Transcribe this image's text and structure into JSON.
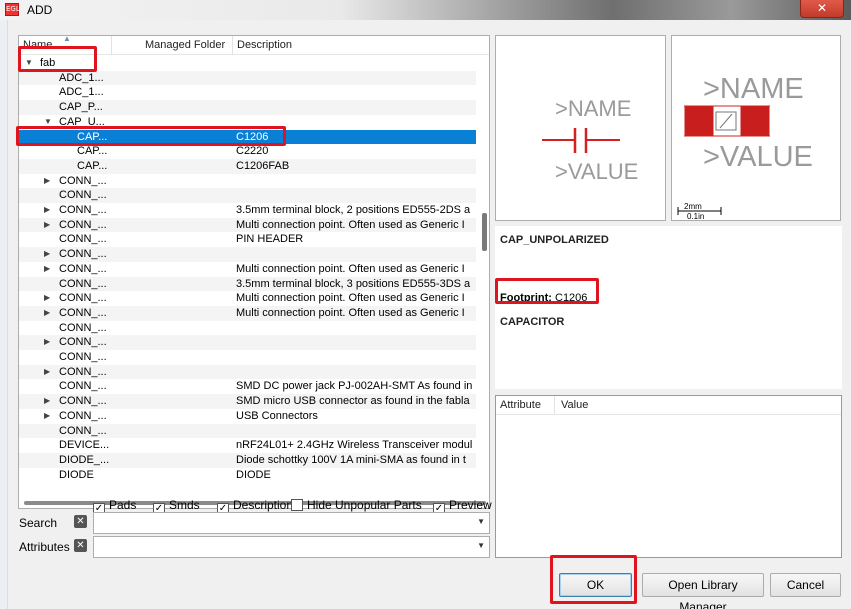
{
  "window": {
    "title": "ADD",
    "app_icon_text": "EGL",
    "close_glyph": "✕"
  },
  "tree": {
    "columns": [
      "Name",
      "Managed Folder",
      "Description"
    ],
    "rows": [
      {
        "name": "fab",
        "desc": "",
        "level": 0,
        "arrow": "▼"
      },
      {
        "name": "ADC_1...",
        "desc": "",
        "level": 1,
        "arrow": ""
      },
      {
        "name": "ADC_1...",
        "desc": "",
        "level": 1,
        "arrow": ""
      },
      {
        "name": "CAP_P...",
        "desc": "",
        "level": 1,
        "arrow": ""
      },
      {
        "name": "CAP_U...",
        "desc": "",
        "level": 1,
        "arrow": "▼"
      },
      {
        "name": "CAP...",
        "desc": "C1206",
        "level": 2,
        "arrow": "",
        "selected": true
      },
      {
        "name": "CAP...",
        "desc": "C2220",
        "level": 2,
        "arrow": ""
      },
      {
        "name": "CAP...",
        "desc": "C1206FAB",
        "level": 2,
        "arrow": ""
      },
      {
        "name": "CONN_...",
        "desc": "",
        "level": 1,
        "arrow": "▶"
      },
      {
        "name": "CONN_...",
        "desc": "",
        "level": 1,
        "arrow": ""
      },
      {
        "name": "CONN_...",
        "desc": "3.5mm terminal block, 2 positions ED555-2DS a",
        "level": 1,
        "arrow": "▶"
      },
      {
        "name": "CONN_...",
        "desc": "Multi connection point. Often used as Generic I",
        "level": 1,
        "arrow": "▶"
      },
      {
        "name": "CONN_...",
        "desc": "PIN HEADER",
        "level": 1,
        "arrow": ""
      },
      {
        "name": "CONN_...",
        "desc": "",
        "level": 1,
        "arrow": "▶"
      },
      {
        "name": "CONN_...",
        "desc": "Multi connection point. Often used as Generic I",
        "level": 1,
        "arrow": "▶"
      },
      {
        "name": "CONN_...",
        "desc": "3.5mm terminal block, 3 positions ED555-3DS a",
        "level": 1,
        "arrow": ""
      },
      {
        "name": "CONN_...",
        "desc": "Multi connection point. Often used as Generic I",
        "level": 1,
        "arrow": "▶"
      },
      {
        "name": "CONN_...",
        "desc": "Multi connection point. Often used as Generic I",
        "level": 1,
        "arrow": "▶"
      },
      {
        "name": "CONN_...",
        "desc": "",
        "level": 1,
        "arrow": ""
      },
      {
        "name": "CONN_...",
        "desc": "",
        "level": 1,
        "arrow": "▶"
      },
      {
        "name": "CONN_...",
        "desc": "",
        "level": 1,
        "arrow": ""
      },
      {
        "name": "CONN_...",
        "desc": "",
        "level": 1,
        "arrow": "▶"
      },
      {
        "name": "CONN_...",
        "desc": "SMD DC power jack PJ-002AH-SMT As found in",
        "level": 1,
        "arrow": ""
      },
      {
        "name": "CONN_...",
        "desc": "SMD micro USB connector as found in the fabla",
        "level": 1,
        "arrow": "▶"
      },
      {
        "name": "CONN_...",
        "desc": "USB Connectors",
        "level": 1,
        "arrow": "▶"
      },
      {
        "name": "CONN_...",
        "desc": "",
        "level": 1,
        "arrow": ""
      },
      {
        "name": "DEVICE...",
        "desc": "nRF24L01+ 2.4GHz Wireless Transceiver modul",
        "level": 1,
        "arrow": ""
      },
      {
        "name": "DIODE_...",
        "desc": "Diode schottky 100V 1A mini-SMA as found in t",
        "level": 1,
        "arrow": ""
      },
      {
        "name": "DIODE",
        "desc": "DIODE",
        "level": 1,
        "arrow": ""
      }
    ]
  },
  "options": {
    "pads": {
      "label": "Pads",
      "checked": true
    },
    "smds": {
      "label": "Smds",
      "checked": true
    },
    "description": {
      "label": "Description",
      "checked": true
    },
    "hide_unpopular": {
      "label": "Hide Unpopular Parts",
      "checked": false
    },
    "preview": {
      "label": "Preview",
      "checked": true
    }
  },
  "search": {
    "label": "Search",
    "value": ""
  },
  "attributes_filter": {
    "label": "Attributes",
    "value": ""
  },
  "symbol_preview": {
    "name_text": ">NAME",
    "value_text": ">VALUE"
  },
  "package_preview": {
    "name_text": ">NAME",
    "value_text": ">VALUE",
    "scale_mm": "2mm",
    "scale_in": "0.1in"
  },
  "part_info": {
    "name": "CAP_UNPOLARIZED",
    "footprint_label": "Footprint:",
    "footprint_value": "C1206",
    "description": "CAPACITOR"
  },
  "attributes_table": {
    "columns": [
      "Attribute",
      "Value"
    ]
  },
  "buttons": {
    "ok": "OK",
    "open_library_manager": "Open Library Manager",
    "cancel": "Cancel"
  },
  "colors": {
    "selection": "#0a7fd6",
    "highlight_box": "#e0141e",
    "symbol": "#d32020",
    "pad": "#c81e1e"
  }
}
